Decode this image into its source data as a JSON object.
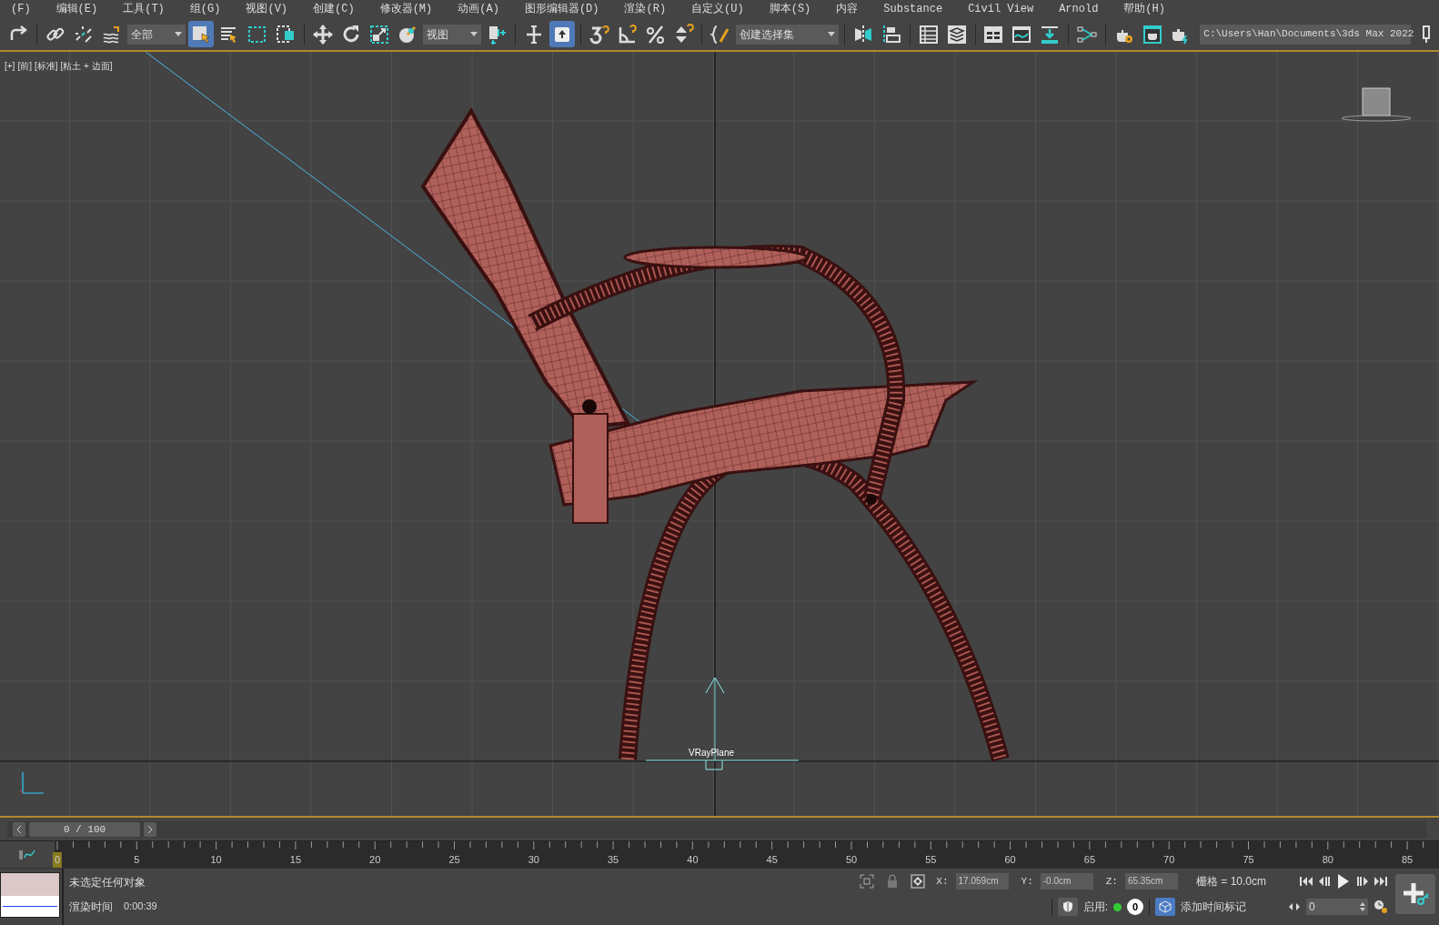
{
  "menu": [
    "(F)",
    "编辑(E)",
    "工具(T)",
    "组(G)",
    "视图(V)",
    "创建(C)",
    "修改器(M)",
    "动画(A)",
    "图形编辑器(D)",
    "渲染(R)",
    "自定义(U)",
    "脚本(S)",
    "内容",
    "Substance",
    "Civil View",
    "Arnold",
    "帮助(H)"
  ],
  "toolbar": [
    {
      "kind": "button",
      "selected": false
    },
    {
      "kind": "separator"
    },
    {
      "kind": "button",
      "selected": false
    },
    {
      "kind": "button",
      "selected": false
    },
    {
      "kind": "button",
      "selected": false
    },
    {
      "kind": "dropdown",
      "value": "全部"
    },
    {
      "kind": "button",
      "selected": true
    },
    {
      "kind": "button",
      "selected": false
    },
    {
      "kind": "button",
      "selected": false
    },
    {
      "kind": "button",
      "selected": false
    },
    {
      "kind": "separator"
    },
    {
      "kind": "button",
      "selected": false
    },
    {
      "kind": "button",
      "selected": false
    },
    {
      "kind": "button",
      "selected": false
    },
    {
      "kind": "button",
      "selected": false
    },
    {
      "kind": "dropdown",
      "value": "视图"
    },
    {
      "kind": "button",
      "selected": false
    },
    {
      "kind": "separator"
    },
    {
      "kind": "button",
      "selected": false
    },
    {
      "kind": "button",
      "selected": true
    },
    {
      "kind": "separator"
    },
    {
      "kind": "button",
      "selected": false
    },
    {
      "kind": "button",
      "selected": false
    },
    {
      "kind": "button",
      "selected": false
    },
    {
      "kind": "button",
      "selected": false
    },
    {
      "kind": "separator"
    },
    {
      "kind": "button",
      "selected": false
    },
    {
      "kind": "dropdown",
      "value": "创建选择集"
    },
    {
      "kind": "separator"
    },
    {
      "kind": "button",
      "selected": false
    },
    {
      "kind": "button",
      "selected": false
    },
    {
      "kind": "separator"
    },
    {
      "kind": "button",
      "selected": false
    },
    {
      "kind": "button",
      "selected": false
    },
    {
      "kind": "separator"
    },
    {
      "kind": "button",
      "selected": false
    },
    {
      "kind": "button",
      "selected": false
    },
    {
      "kind": "button",
      "selected": false
    },
    {
      "kind": "separator"
    },
    {
      "kind": "button",
      "selected": false
    },
    {
      "kind": "separator"
    },
    {
      "kind": "button",
      "selected": false
    },
    {
      "kind": "button",
      "selected": false
    },
    {
      "kind": "button",
      "selected": false
    },
    {
      "kind": "path",
      "value": "C:\\Users\\Han\\Documents\\3ds Max 2022"
    },
    {
      "kind": "button",
      "selected": false
    }
  ],
  "viewport": {
    "labels": [
      "[+]",
      "[前]",
      "[标准]",
      "[粘土 + 边面]"
    ],
    "object_label": "VRayPlane"
  },
  "time_slider": {
    "position": "0 / 100",
    "level": 0
  },
  "timeline": {
    "labels": [
      "0",
      "5",
      "10",
      "15",
      "20",
      "25",
      "30",
      "35",
      "40",
      "45",
      "50",
      "55",
      "60",
      "65",
      "70",
      "75",
      "80",
      "85"
    ]
  },
  "status": {
    "selection": "未选定任何对象",
    "render_time_label": "渲染时间",
    "render_time": "0:00:39",
    "coords": [
      {
        "axis": "X:",
        "value": "17.059cm"
      },
      {
        "axis": "Y:",
        "value": "-0.0cm"
      },
      {
        "axis": "Z:",
        "value": "65.35cm"
      }
    ],
    "grid": "栅格 = 10.0cm",
    "enable_label": "启用:",
    "enable_count": "0",
    "add_time_tag": "添加时间标记",
    "frame": "0"
  }
}
